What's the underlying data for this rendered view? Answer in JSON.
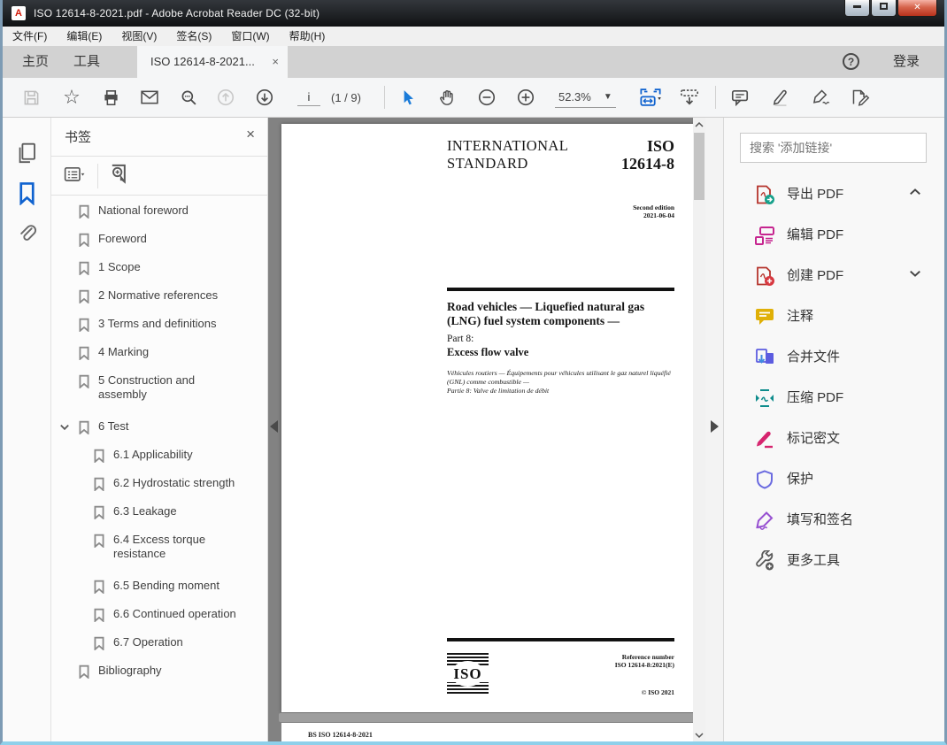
{
  "window": {
    "title": "ISO 12614-8-2021.pdf - Adobe Acrobat Reader DC (32-bit)",
    "pdf_icon_letter": "A"
  },
  "menu_bar": {
    "items": [
      "文件(F)",
      "编辑(E)",
      "视图(V)",
      "签名(S)",
      "窗口(W)",
      "帮助(H)"
    ]
  },
  "tab_bar": {
    "home": "主页",
    "tools": "工具",
    "document_tab": "ISO 12614-8-2021...",
    "close_glyph": "×",
    "help_glyph": "?",
    "sign_in": "登录"
  },
  "toolbar": {
    "page_input_value": "i",
    "page_indicator": "(1 / 9)",
    "zoom_value": "52.3%"
  },
  "bookmarks_panel": {
    "title": "书签",
    "close_glyph": "×",
    "items": [
      {
        "label": "National foreword",
        "level": 0
      },
      {
        "label": "Foreword",
        "level": 0
      },
      {
        "label": "1 Scope",
        "level": 0
      },
      {
        "label": "2 Normative references",
        "level": 0
      },
      {
        "label": "3 Terms and definitions",
        "level": 0
      },
      {
        "label": "4 Marking",
        "level": 0
      },
      {
        "label": "5 Construction and assembly",
        "level": 0
      },
      {
        "label": "6 Test",
        "level": 0,
        "expanded": true
      },
      {
        "label": "6.1 Applicability",
        "level": 1
      },
      {
        "label": "6.2 Hydrostatic strength",
        "level": 1
      },
      {
        "label": "6.3 Leakage",
        "level": 1
      },
      {
        "label": "6.4 Excess torque resistance",
        "level": 1
      },
      {
        "label": "6.5 Bending moment",
        "level": 1
      },
      {
        "label": "6.6 Continued operation",
        "level": 1
      },
      {
        "label": "6.7 Operation",
        "level": 1
      },
      {
        "label": "Bibliography",
        "level": 0
      }
    ]
  },
  "document": {
    "header_left_line1": "INTERNATIONAL",
    "header_left_line2": "STANDARD",
    "header_right_line1": "ISO",
    "header_right_line2": "12614-8",
    "edition_line1": "Second edition",
    "edition_line2": "2021-06-04",
    "title_en": "Road vehicles — Liquefied natural gas (LNG) fuel system components —",
    "part_label": "Part 8:",
    "part_title": "Excess flow valve",
    "title_fr": "Véhicules routiers — Équipements pour véhicules utilisant le gaz naturel liquéfié (GNL) comme combustible —",
    "part_fr": "Partie 8: Valve de limitation de débit",
    "iso_logo_text": "ISO",
    "reference_label": "Reference number",
    "reference_number": "ISO 12614-8:2021(E)",
    "copyright": "© ISO 2021",
    "next_page_text": "BS ISO 12614-8-2021"
  },
  "tools_panel": {
    "search_placeholder": "搜索 '添加链接'",
    "tools": [
      {
        "label": "导出 PDF",
        "icon": "export-pdf-icon",
        "chevron": "up",
        "color": "#17a18b"
      },
      {
        "label": "编辑 PDF",
        "icon": "edit-pdf-icon",
        "color": "#c6258f"
      },
      {
        "label": "创建 PDF",
        "icon": "create-pdf-icon",
        "chevron": "down",
        "color": "#d7373f"
      },
      {
        "label": "注释",
        "icon": "comment-icon",
        "color": "#e0b007"
      },
      {
        "label": "合并文件",
        "icon": "combine-files-icon",
        "color": "#5c5ce0"
      },
      {
        "label": "压缩 PDF",
        "icon": "compress-pdf-icon",
        "color": "#0e8c8c"
      },
      {
        "label": "标记密文",
        "icon": "redact-icon",
        "color": "#d6246e"
      },
      {
        "label": "保护",
        "icon": "protect-icon",
        "color": "#6b6be0"
      },
      {
        "label": "填写和签名",
        "icon": "fill-sign-icon",
        "color": "#9750d1"
      },
      {
        "label": "更多工具",
        "icon": "more-tools-icon",
        "color": "#5a5a5a"
      }
    ]
  },
  "colors": {
    "accent_blue": "#0f62cf",
    "titlebar": "#1c1f23",
    "doc_background": "#828282",
    "close_button_red": "#c0392b",
    "window_border": "#7d9bb4"
  }
}
